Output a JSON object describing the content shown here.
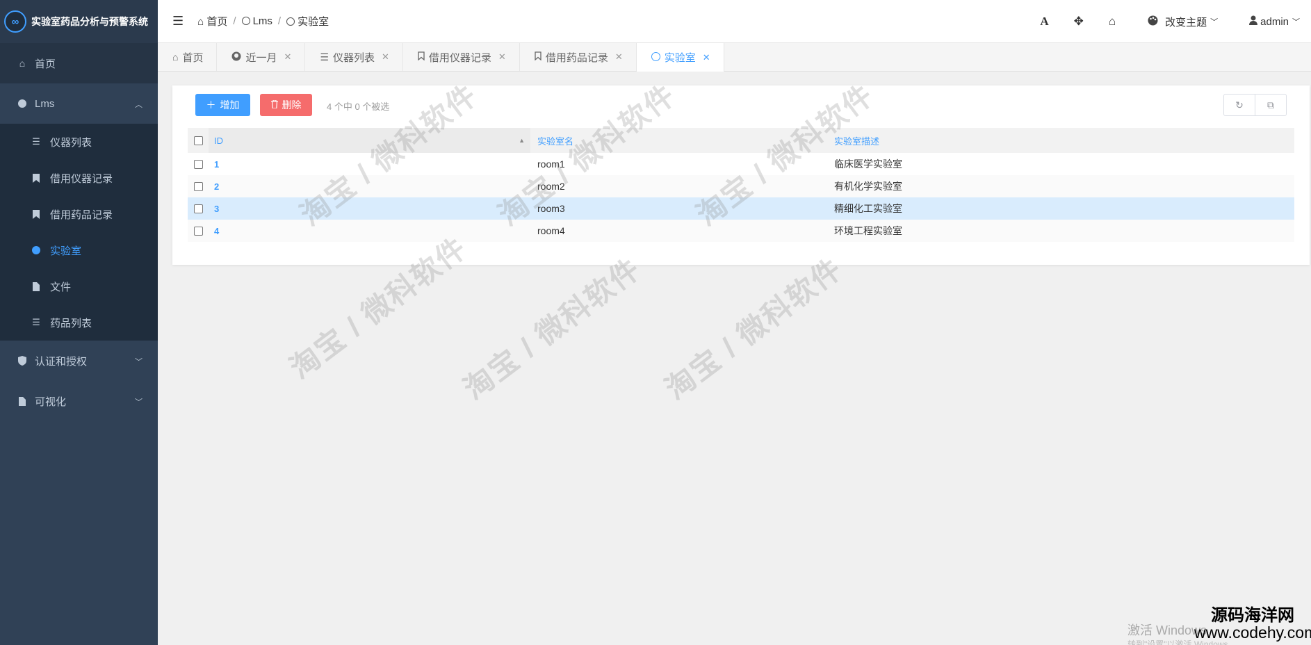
{
  "app": {
    "title": "实验室药品分析与预警系统",
    "logo_text": "∞"
  },
  "sidebar": {
    "home": "首页",
    "lms": {
      "label": "Lms",
      "items": [
        {
          "label": "仪器列表"
        },
        {
          "label": "借用仪器记录"
        },
        {
          "label": "借用药品记录"
        },
        {
          "label": "实验室"
        },
        {
          "label": "文件"
        },
        {
          "label": "药品列表"
        }
      ]
    },
    "auth": "认证和授权",
    "visual": "可视化"
  },
  "navbar": {
    "breadcrumb": [
      "首页",
      "Lms",
      "实验室"
    ],
    "theme_label": "改变主题",
    "user_label": "admin",
    "font_icon": "A"
  },
  "tags": [
    {
      "label": "首页"
    },
    {
      "label": "近一月"
    },
    {
      "label": "仪器列表"
    },
    {
      "label": "借用仪器记录"
    },
    {
      "label": "借用药品记录"
    },
    {
      "label": "实验室"
    }
  ],
  "toolbar": {
    "add_label": "增加",
    "delete_label": "删除",
    "selection_info": "4 个中 0 个被选"
  },
  "table": {
    "columns": [
      "ID",
      "实验室名",
      "实验室描述"
    ],
    "rows": [
      {
        "id": "1",
        "name": "room1",
        "desc": "临床医学实验室"
      },
      {
        "id": "2",
        "name": "room2",
        "desc": "有机化学实验室"
      },
      {
        "id": "3",
        "name": "room3",
        "desc": "精细化工实验室"
      },
      {
        "id": "4",
        "name": "room4",
        "desc": "环境工程实验室"
      }
    ]
  },
  "watermark": "淘宝 / 微科软件",
  "overlay": {
    "win_activate": "激活 Windows",
    "win_hint": "转到\"设置\"以激活 Windows",
    "site_cn": "源码海洋网",
    "site_url": "www.codehy.com"
  },
  "colors": {
    "accent": "#409eff",
    "danger": "#f56c6c",
    "sidebar_bg": "#304156",
    "row_highlight": "#d9ecfd"
  }
}
